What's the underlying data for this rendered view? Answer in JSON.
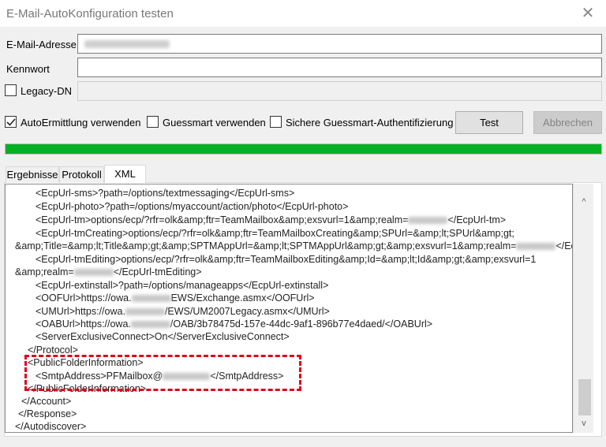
{
  "window": {
    "title": "E-Mail-AutoKonfiguration testen",
    "close_glyph": "✕"
  },
  "form": {
    "email_label": "E-Mail-Adresse",
    "password_label": "Kennwort",
    "legacy_dn_label": "Legacy-DN"
  },
  "options": {
    "auto_label": "AutoErmittlung verwenden",
    "auto_checked": true,
    "guessmart_label": "Guessmart verwenden",
    "guessmart_checked": false,
    "secure_guessmart_label": "Sichere Guessmart-Authentifizierung",
    "secure_guessmart_checked": false,
    "legacy_dn_checked": false
  },
  "buttons": {
    "test_label": "Test",
    "cancel_label": "Abbrechen",
    "cancel_disabled": true
  },
  "progress": {
    "fraction": 1.0,
    "color": "#06b025"
  },
  "tabs": [
    {
      "label": "Ergebnisse",
      "active": false
    },
    {
      "label": "Protokoll",
      "active": false
    },
    {
      "label": "XML",
      "active": true
    }
  ],
  "xml_lines": {
    "l01": "<EcpUrl-sms>?path=/options/textmessaging</EcpUrl-sms>",
    "l02": "<EcpUrl-photo>?path=/options/myaccount/action/photo</EcpUrl-photo>",
    "l03a": "<EcpUrl-tm>options/ecp/?rfr=olk&amp;ftr=TeamMailbox&amp;exsvurl=1&amp;realm=",
    "l03b": "</EcpUrl-tm>",
    "l04": "<EcpUrl-tmCreating>options/ecp/?rfr=olk&amp;ftr=TeamMailboxCreating&amp;SPUrl=&amp;lt;SPUrl&amp;gt;",
    "l05a": "&amp;Title=&amp;lt;Title&amp;gt;&amp;SPTMAppUrl=&amp;lt;SPTMAppUrl&amp;gt;&amp;exsvurl=1&amp;realm=",
    "l05b": "</EcpUrl-tmCreating>",
    "l06": "<EcpUrl-tmEditing>options/ecp/?rfr=olk&amp;ftr=TeamMailboxEditing&amp;Id=&amp;lt;Id&amp;gt;&amp;exsvurl=1",
    "l07a": "&amp;realm=",
    "l07b": "</EcpUrl-tmEditing>",
    "l08": "<EcpUrl-extinstall>?path=/options/manageapps</EcpUrl-extinstall>",
    "l09a": "<OOFUrl>https://owa.",
    "l09b": "EWS/Exchange.asmx</OOFUrl>",
    "l10a": "<UMUrl>https://owa.",
    "l10b": "/EWS/UM2007Legacy.asmx</UMUrl>",
    "l11a": "<OABUrl>https://owa.",
    "l11b": "/OAB/3b78475d-157e-44dc-9af1-896b77e4daed/</OABUrl>",
    "l12": "<ServerExclusiveConnect>On</ServerExclusiveConnect>",
    "l13": "</Protocol>",
    "l14": "<PublicFolderInformation>",
    "l15a": "<SmtpAddress>PFMailbox@",
    "l15b": "</SmtpAddress>",
    "l16": "</PublicFolderInformation>",
    "l17": "</Account>",
    "l18": "</Response>",
    "l19": "</Autodiscover>"
  },
  "scrollbar": {
    "up_glyph": "^",
    "down_glyph": "v"
  },
  "colors": {
    "highlight": "#e0001a",
    "accent": "#06b025"
  }
}
